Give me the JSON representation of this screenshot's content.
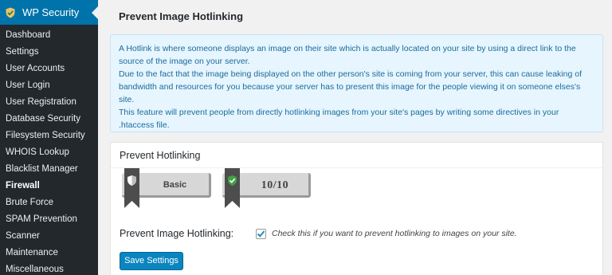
{
  "sidebar": {
    "title": "WP Security",
    "items": [
      {
        "label": "Dashboard"
      },
      {
        "label": "Settings"
      },
      {
        "label": "User Accounts"
      },
      {
        "label": "User Login"
      },
      {
        "label": "User Registration"
      },
      {
        "label": "Database Security"
      },
      {
        "label": "Filesystem Security"
      },
      {
        "label": "WHOIS Lookup"
      },
      {
        "label": "Blacklist Manager"
      },
      {
        "label": "Firewall",
        "active": true
      },
      {
        "label": "Brute Force"
      },
      {
        "label": "SPAM Prevention"
      },
      {
        "label": "Scanner"
      },
      {
        "label": "Maintenance"
      },
      {
        "label": "Miscellaneous"
      }
    ]
  },
  "main": {
    "title": "Prevent Image Hotlinking",
    "notice": {
      "lines": [
        "A Hotlink is where someone displays an image on their site which is actually located on your site by using a direct link to the source of the image on your server.",
        "Due to the fact that the image being displayed on the other person's site is coming from your server, this can cause leaking of bandwidth and resources for you because your server has to present this image for the people viewing it on someone elses's site.",
        "This feature will prevent people from directly hotlinking images from your site's pages by writing some directives in your .htaccess file."
      ]
    },
    "panel": {
      "title": "Prevent Hotlinking",
      "badges": [
        {
          "text": "Basic",
          "icon": "shield-icon"
        },
        {
          "text": "10/10",
          "icon": "shield-check-icon"
        }
      ],
      "option": {
        "label": "Prevent Image Hotlinking:",
        "checked": true,
        "description": "Check this if you want to prevent hotlinking to images on your site."
      },
      "save_label": "Save Settings"
    }
  },
  "colors": {
    "sidebar_bg": "#23282d",
    "accent": "#0073aa",
    "notice_bg": "#e7f5fe",
    "notice_text": "#1a6c9c",
    "button": "#0a85bf"
  }
}
